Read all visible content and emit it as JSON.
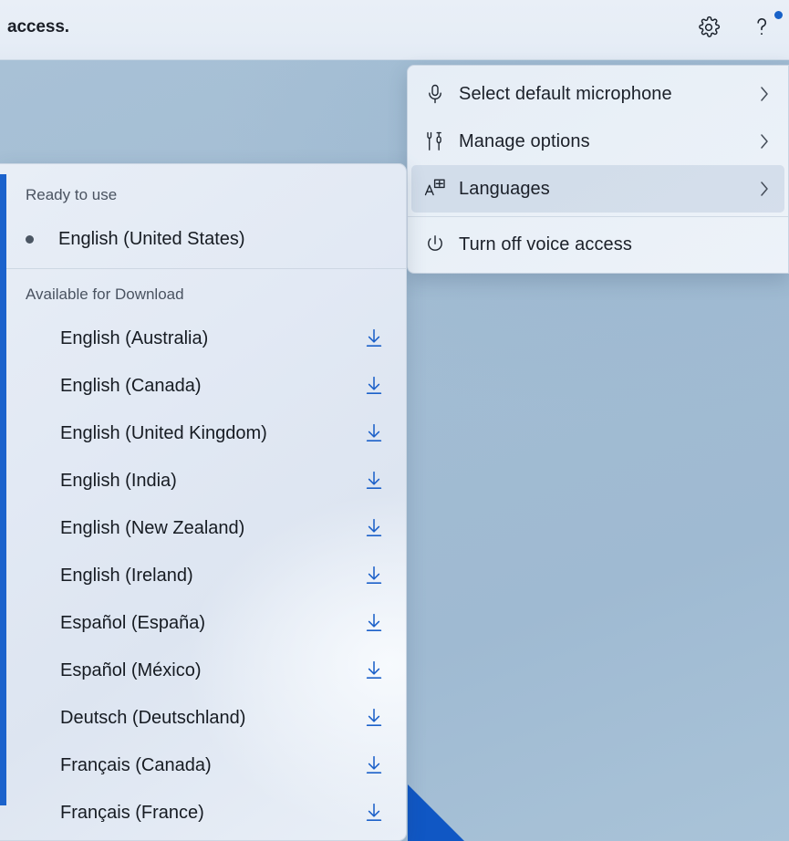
{
  "titlebar": {
    "app_title": "access.",
    "settings_icon": "gear-icon",
    "help_icon": "question-mark-icon",
    "help_badge_color": "#1761c8"
  },
  "context_menu": {
    "items": [
      {
        "label": "Select default microphone",
        "icon": "microphone-icon",
        "has_submenu": true,
        "chevron": "›",
        "highlighted": false
      },
      {
        "label": "Manage options",
        "icon": "tools-icon",
        "has_submenu": true,
        "chevron": "›",
        "highlighted": false
      },
      {
        "label": "Languages",
        "icon": "translate-icon",
        "has_submenu": true,
        "chevron": "›",
        "highlighted": true
      },
      {
        "label": "Turn off voice access",
        "icon": "power-icon",
        "has_submenu": false,
        "chevron": "",
        "highlighted": false
      }
    ]
  },
  "language_panel": {
    "ready_header": "Ready to use",
    "available_header": "Available for Download",
    "installed": [
      {
        "name": "English (United States)",
        "selected": true
      }
    ],
    "available": [
      {
        "name": "English (Australia)",
        "action_icon": "download-icon"
      },
      {
        "name": "English (Canada)",
        "action_icon": "download-icon"
      },
      {
        "name": "English (United Kingdom)",
        "action_icon": "download-icon"
      },
      {
        "name": "English (India)",
        "action_icon": "download-icon"
      },
      {
        "name": "English (New Zealand)",
        "action_icon": "download-icon"
      },
      {
        "name": "English (Ireland)",
        "action_icon": "download-icon"
      },
      {
        "name": "Español (España)",
        "action_icon": "download-icon"
      },
      {
        "name": "Español (México)",
        "action_icon": "download-icon"
      },
      {
        "name": "Deutsch (Deutschland)",
        "action_icon": "download-icon"
      },
      {
        "name": "Français (Canada)",
        "action_icon": "download-icon"
      },
      {
        "name": "Français (France)",
        "action_icon": "download-icon"
      }
    ],
    "focus_bar_color": "#1b62cc",
    "download_icon_color": "#1b60c9"
  }
}
